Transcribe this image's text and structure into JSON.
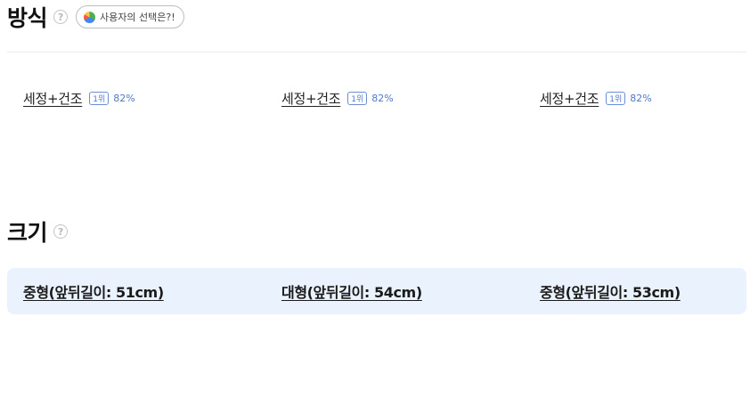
{
  "method_section": {
    "title": "방식",
    "help_icon_glyph": "?",
    "choice_pill": {
      "label": "사용자의 선택은?!",
      "icon": "pie-chart-icon"
    },
    "items": [
      {
        "name": "세정+건조",
        "rank": "1위",
        "percent": "82%"
      },
      {
        "name": "세정+건조",
        "rank": "1위",
        "percent": "82%"
      },
      {
        "name": "세정+건조",
        "rank": "1위",
        "percent": "82%"
      }
    ]
  },
  "size_section": {
    "title": "크기",
    "help_icon_glyph": "?",
    "items": [
      {
        "label": "중형(앞뒤길이: 51cm)"
      },
      {
        "label": "대형(앞뒤길이: 54cm)"
      },
      {
        "label": "중형(앞뒤길이: 53cm)"
      }
    ]
  },
  "colors": {
    "accent": "#4f78c9",
    "size_box_bg": "#eaf2fd",
    "divider": "#ececec"
  }
}
